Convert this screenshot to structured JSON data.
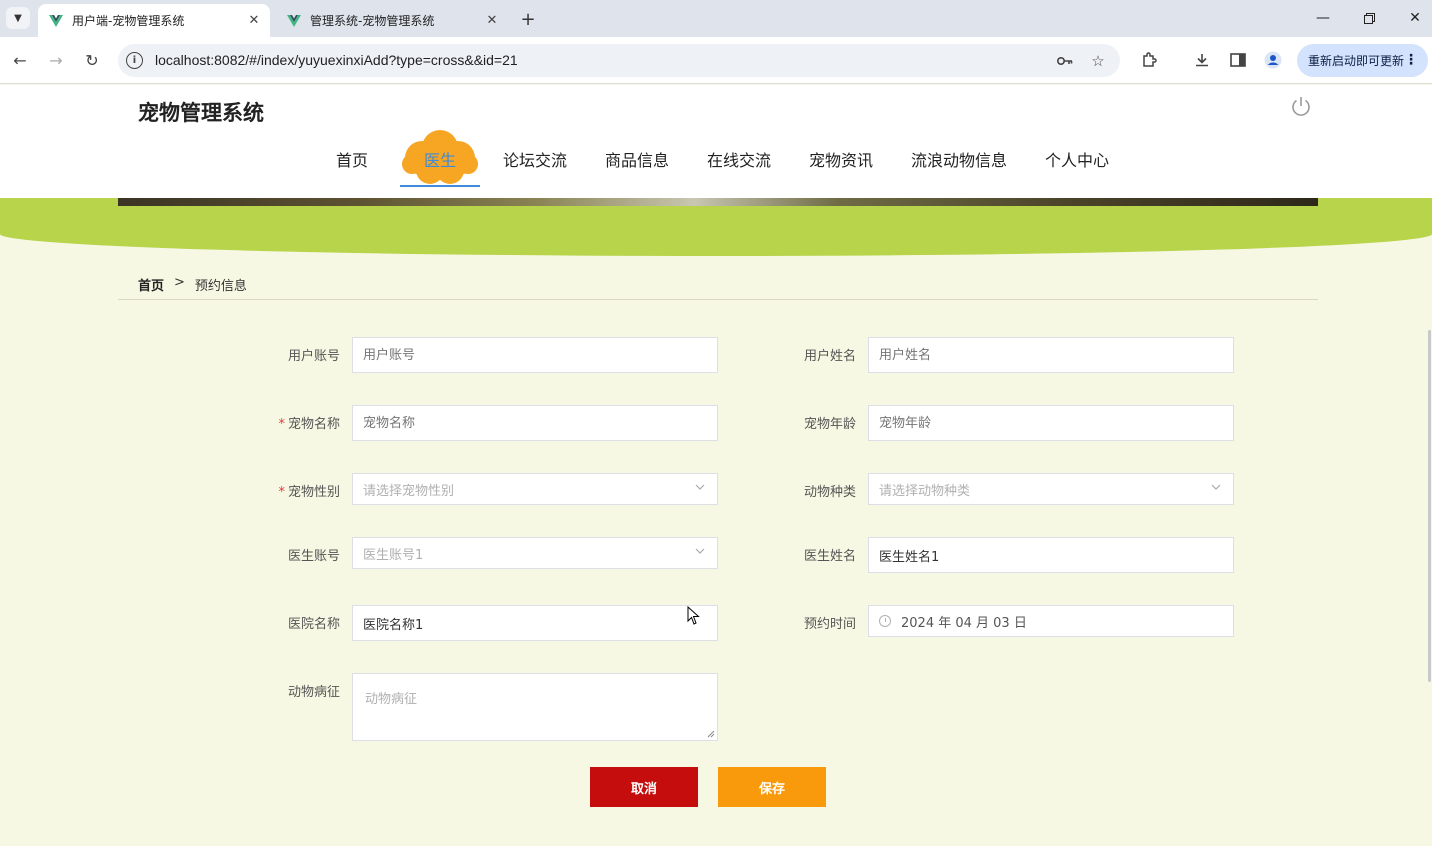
{
  "browser": {
    "tabs": [
      {
        "title": "用户端-宠物管理系统",
        "active": true
      },
      {
        "title": "管理系统-宠物管理系统",
        "active": false
      }
    ],
    "url": "localhost:8082/#/index/yuyuexinxiAdd?type=cross&&id=21",
    "update_label": "重新启动即可更新"
  },
  "site": {
    "title": "宠物管理系统",
    "nav": [
      "首页",
      "医生",
      "论坛交流",
      "商品信息",
      "在线交流",
      "宠物资讯",
      "流浪动物信息",
      "个人中心"
    ],
    "active_nav": "医生",
    "accent_color": "#3d8bd9",
    "banner_color": "#b7d44a"
  },
  "breadcrumb": {
    "home": "首页",
    "separator": ">",
    "current": "预约信息"
  },
  "form": {
    "required_mark": "*",
    "fields": {
      "user_account": {
        "label": "用户账号",
        "placeholder": "用户账号"
      },
      "user_name": {
        "label": "用户姓名",
        "placeholder": "用户姓名"
      },
      "pet_name": {
        "label": "宠物名称",
        "placeholder": "宠物名称",
        "required": true
      },
      "pet_age": {
        "label": "宠物年龄",
        "placeholder": "宠物年龄"
      },
      "pet_gender": {
        "label": "宠物性别",
        "placeholder": "请选择宠物性别",
        "required": true
      },
      "animal_type": {
        "label": "动物种类",
        "placeholder": "请选择动物种类"
      },
      "doctor_account": {
        "label": "医生账号",
        "value": "医生账号1"
      },
      "doctor_name": {
        "label": "医生姓名",
        "value": "医生姓名1"
      },
      "hospital_name": {
        "label": "医院名称",
        "value": "医院名称1"
      },
      "appointment_time": {
        "label": "预约时间",
        "value": "2024 年 04 月 03 日"
      },
      "symptoms": {
        "label": "动物病征",
        "placeholder": "动物病征"
      }
    },
    "buttons": {
      "cancel": "取消",
      "save": "保存"
    },
    "cancel_color": "#c50d0d",
    "save_color": "#f89a0b"
  }
}
